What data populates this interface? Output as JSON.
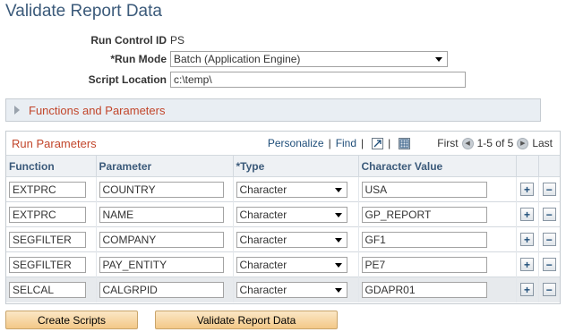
{
  "page": {
    "title": "Validate Report Data"
  },
  "form": {
    "run_control_label": "Run Control ID",
    "run_control_value": "PS",
    "run_mode_label": "*Run Mode",
    "run_mode_value": "Batch (Application Engine)",
    "script_location_label": "Script Location",
    "script_location_value": "c:\\temp\\"
  },
  "functions_section": {
    "title": "Functions and Parameters"
  },
  "grid": {
    "title": "Run Parameters",
    "personalize": "Personalize",
    "separator": "|",
    "find": "Find",
    "first": "First",
    "range": "1-5 of 5",
    "last": "Last",
    "columns": [
      "Function",
      "Parameter",
      "*Type",
      "Character Value"
    ],
    "rows": [
      {
        "function": "EXTPRC",
        "parameter": "COUNTRY",
        "type": "Character",
        "value": "USA"
      },
      {
        "function": "EXTPRC",
        "parameter": "NAME",
        "type": "Character",
        "value": "GP_REPORT"
      },
      {
        "function": "SEGFILTER",
        "parameter": "COMPANY",
        "type": "Character",
        "value": "GF1"
      },
      {
        "function": "SEGFILTER",
        "parameter": "PAY_ENTITY",
        "type": "Character",
        "value": "PE7"
      },
      {
        "function": "SELCAL",
        "parameter": "CALGRPID",
        "type": "Character",
        "value": "GDAPR01"
      }
    ],
    "add_symbol": "+",
    "remove_symbol": "−"
  },
  "buttons": {
    "create_scripts": "Create Scripts",
    "validate_report_data": "Validate Report Data"
  }
}
